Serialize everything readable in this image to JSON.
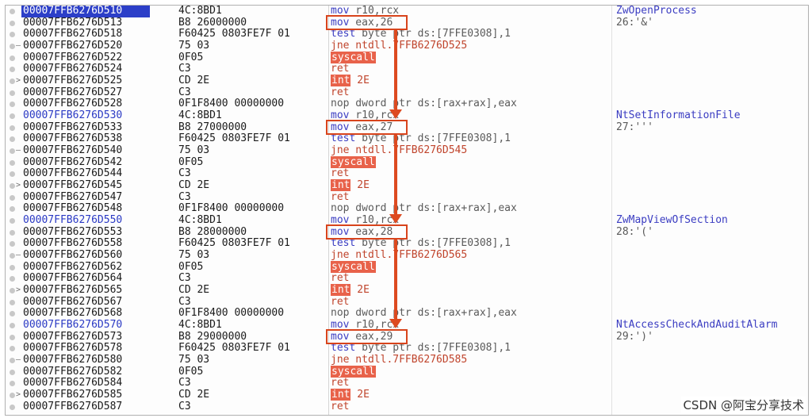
{
  "rows": [
    {
      "addr": "00007FFB6276D510",
      "addr_style": "cur",
      "bytes": "4C:8BD1",
      "mnem": "mov",
      "ops": "r10,rcx",
      "comment": "ZwOpenProcess",
      "comment_fn": true,
      "gutter": ""
    },
    {
      "addr": "00007FFB6276D513",
      "bytes": "B8 26000000",
      "mnem": "mov",
      "ops": "eax,26",
      "comment": "26:'&'",
      "gutter": ""
    },
    {
      "addr": "00007FFB6276D518",
      "bytes": "F60425 0803FE7F 01",
      "mnem": "test",
      "ops": "byte ptr ds:[7FFE0308],1",
      "comment": "",
      "gutter": ""
    },
    {
      "addr": "00007FFB6276D520",
      "bytes": "75 03",
      "mnem": "jne",
      "ops": "ntdll.7FFB6276D525",
      "comment": "",
      "gutter": "–"
    },
    {
      "addr": "00007FFB6276D522",
      "bytes": "0F05",
      "mnem": "syscall",
      "ops": "",
      "comment": "",
      "gutter": ""
    },
    {
      "addr": "00007FFB6276D524",
      "bytes": "C3",
      "mnem": "ret",
      "ops": "",
      "comment": "",
      "gutter": ""
    },
    {
      "addr": "00007FFB6276D525",
      "bytes": "CD 2E",
      "mnem": "int",
      "ops": "2E",
      "comment": "",
      "gutter": ">"
    },
    {
      "addr": "00007FFB6276D527",
      "bytes": "C3",
      "mnem": "ret",
      "ops": "",
      "comment": "",
      "gutter": ""
    },
    {
      "addr": "00007FFB6276D528",
      "bytes": "0F1F8400 00000000",
      "mnem": "nop",
      "ops": "dword ptr ds:[rax+rax],eax",
      "comment": "",
      "gutter": ""
    },
    {
      "addr": "00007FFB6276D530",
      "addr_style": "lbl",
      "bytes": "4C:8BD1",
      "mnem": "mov",
      "ops": "r10,rcx",
      "comment": "NtSetInformationFile",
      "comment_fn": true,
      "gutter": ""
    },
    {
      "addr": "00007FFB6276D533",
      "bytes": "B8 27000000",
      "mnem": "mov",
      "ops": "eax,27",
      "comment": "27:'''",
      "gutter": ""
    },
    {
      "addr": "00007FFB6276D538",
      "bytes": "F60425 0803FE7F 01",
      "mnem": "test",
      "ops": "byte ptr ds:[7FFE0308],1",
      "comment": "",
      "gutter": ""
    },
    {
      "addr": "00007FFB6276D540",
      "bytes": "75 03",
      "mnem": "jne",
      "ops": "ntdll.7FFB6276D545",
      "comment": "",
      "gutter": "–"
    },
    {
      "addr": "00007FFB6276D542",
      "bytes": "0F05",
      "mnem": "syscall",
      "ops": "",
      "comment": "",
      "gutter": ""
    },
    {
      "addr": "00007FFB6276D544",
      "bytes": "C3",
      "mnem": "ret",
      "ops": "",
      "comment": "",
      "gutter": ""
    },
    {
      "addr": "00007FFB6276D545",
      "bytes": "CD 2E",
      "mnem": "int",
      "ops": "2E",
      "comment": "",
      "gutter": ">"
    },
    {
      "addr": "00007FFB6276D547",
      "bytes": "C3",
      "mnem": "ret",
      "ops": "",
      "comment": "",
      "gutter": ""
    },
    {
      "addr": "00007FFB6276D548",
      "bytes": "0F1F8400 00000000",
      "mnem": "nop",
      "ops": "dword ptr ds:[rax+rax],eax",
      "comment": "",
      "gutter": ""
    },
    {
      "addr": "00007FFB6276D550",
      "addr_style": "lbl",
      "bytes": "4C:8BD1",
      "mnem": "mov",
      "ops": "r10,rcx",
      "comment": "ZwMapViewOfSection",
      "comment_fn": true,
      "gutter": ""
    },
    {
      "addr": "00007FFB6276D553",
      "bytes": "B8 28000000",
      "mnem": "mov",
      "ops": "eax,28",
      "comment": "28:'('",
      "gutter": ""
    },
    {
      "addr": "00007FFB6276D558",
      "bytes": "F60425 0803FE7F 01",
      "mnem": "test",
      "ops": "byte ptr ds:[7FFE0308],1",
      "comment": "",
      "gutter": ""
    },
    {
      "addr": "00007FFB6276D560",
      "bytes": "75 03",
      "mnem": "jne",
      "ops": "ntdll.7FFB6276D565",
      "comment": "",
      "gutter": "–"
    },
    {
      "addr": "00007FFB6276D562",
      "bytes": "0F05",
      "mnem": "syscall",
      "ops": "",
      "comment": "",
      "gutter": ""
    },
    {
      "addr": "00007FFB6276D564",
      "bytes": "C3",
      "mnem": "ret",
      "ops": "",
      "comment": "",
      "gutter": ""
    },
    {
      "addr": "00007FFB6276D565",
      "bytes": "CD 2E",
      "mnem": "int",
      "ops": "2E",
      "comment": "",
      "gutter": ">"
    },
    {
      "addr": "00007FFB6276D567",
      "bytes": "C3",
      "mnem": "ret",
      "ops": "",
      "comment": "",
      "gutter": ""
    },
    {
      "addr": "00007FFB6276D568",
      "bytes": "0F1F8400 00000000",
      "mnem": "nop",
      "ops": "dword ptr ds:[rax+rax],eax",
      "comment": "",
      "gutter": ""
    },
    {
      "addr": "00007FFB6276D570",
      "addr_style": "lbl",
      "bytes": "4C:8BD1",
      "mnem": "mov",
      "ops": "r10,rcx",
      "comment": "NtAccessCheckAndAuditAlarm",
      "comment_fn": true,
      "gutter": ""
    },
    {
      "addr": "00007FFB6276D573",
      "bytes": "B8 29000000",
      "mnem": "mov",
      "ops": "eax,29",
      "comment": "29:')'",
      "gutter": ""
    },
    {
      "addr": "00007FFB6276D578",
      "bytes": "F60425 0803FE7F 01",
      "mnem": "test",
      "ops": "byte ptr ds:[7FFE0308],1",
      "comment": "",
      "gutter": ""
    },
    {
      "addr": "00007FFB6276D580",
      "bytes": "75 03",
      "mnem": "jne",
      "ops": "ntdll.7FFB6276D585",
      "comment": "",
      "gutter": "–"
    },
    {
      "addr": "00007FFB6276D582",
      "bytes": "0F05",
      "mnem": "syscall",
      "ops": "",
      "comment": "",
      "gutter": ""
    },
    {
      "addr": "00007FFB6276D584",
      "bytes": "C3",
      "mnem": "ret",
      "ops": "",
      "comment": "",
      "gutter": ""
    },
    {
      "addr": "00007FFB6276D585",
      "bytes": "CD 2E",
      "mnem": "int",
      "ops": "2E",
      "comment": "",
      "gutter": ">"
    },
    {
      "addr": "00007FFB6276D587",
      "bytes": "C3",
      "mnem": "ret",
      "ops": "",
      "comment": "",
      "gutter": ""
    }
  ],
  "watermark": "CSDN @阿宝分享技术",
  "colors": {
    "highlight_box": "#d8441c",
    "arrow": "#dd4a20",
    "selected_address_bg": "#2c3fc8"
  }
}
